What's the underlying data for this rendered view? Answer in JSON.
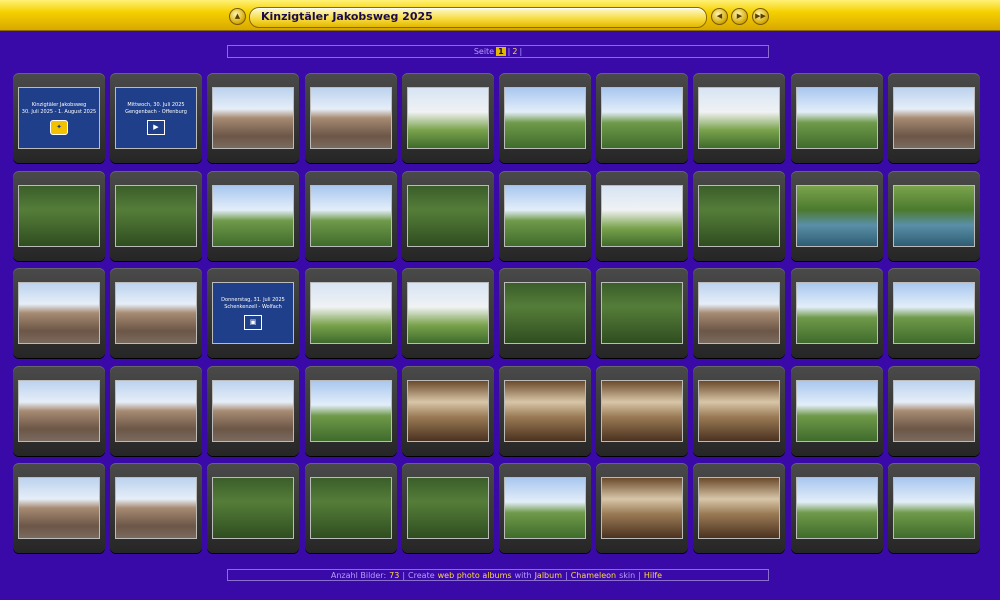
{
  "header": {
    "title": "Kinzigtäler Jakobsweg 2025"
  },
  "nav": {
    "page_label": "Seite",
    "pages": [
      "1",
      "2"
    ],
    "current_page": "1"
  },
  "footer": {
    "count_label": "Anzahl Bilder:",
    "count": "73",
    "create_text": "Create",
    "link_web_albums": "web photo albums",
    "with_text": "with",
    "link_jalbum": "Jalbum",
    "link_skin": "Chameleon",
    "skin_text": "skin",
    "link_help": "Hilfe"
  },
  "text_slides": [
    {
      "line1": "Kinzigtäler Jakobsweg",
      "line2": "30. Juli 2025 - 1. August 2025",
      "icon": "scallop-shell-icon"
    },
    {
      "line1": "Mittwoch, 30. Juli 2025",
      "line2": "Gengenbach - Offenburg",
      "icon": "play-icon"
    },
    {
      "line1": "Donnerstag, 31. Juli 2025",
      "line2": "Schenkenzell - Wolfach",
      "icon": "photo-icon"
    }
  ],
  "colors": {
    "background": "#3a0aa8",
    "gold": "#e2b800",
    "link": "#ffd84a",
    "muted": "#b89bff"
  },
  "thumbnails": [
    [
      "text-slide-1",
      "text-slide-2",
      "town-gate",
      "town-square",
      "pilgrim-sign",
      "field-path",
      "gravel-path",
      "jakobsweg-sign",
      "farm-path",
      "red-barn"
    ],
    [
      "insect-hotel",
      "forest-edge",
      "farm-road",
      "vineyard-view",
      "tree-trunk",
      "meadow",
      "signpost",
      "street-sign",
      "river-path",
      "river"
    ],
    [
      "old-locomotive",
      "red-church",
      "text-slide-3",
      "info-board",
      "memorial-sign",
      "tree-stump",
      "meadow-trees",
      "timber-house",
      "valley-road",
      "rock-wall"
    ],
    [
      "monastery-road",
      "monastery",
      "stone-arch",
      "abbey-garden",
      "church-interior-wood",
      "church-nave",
      "church-altar",
      "church-ceiling",
      "chapel-hillside",
      "half-timbered-house"
    ],
    [
      "fountain",
      "cabin",
      "forest-path",
      "forest-trail",
      "rock-in-forest",
      "small-chapel",
      "chapel-interior",
      "chapel-vault",
      "statue",
      "hill-village"
    ]
  ]
}
